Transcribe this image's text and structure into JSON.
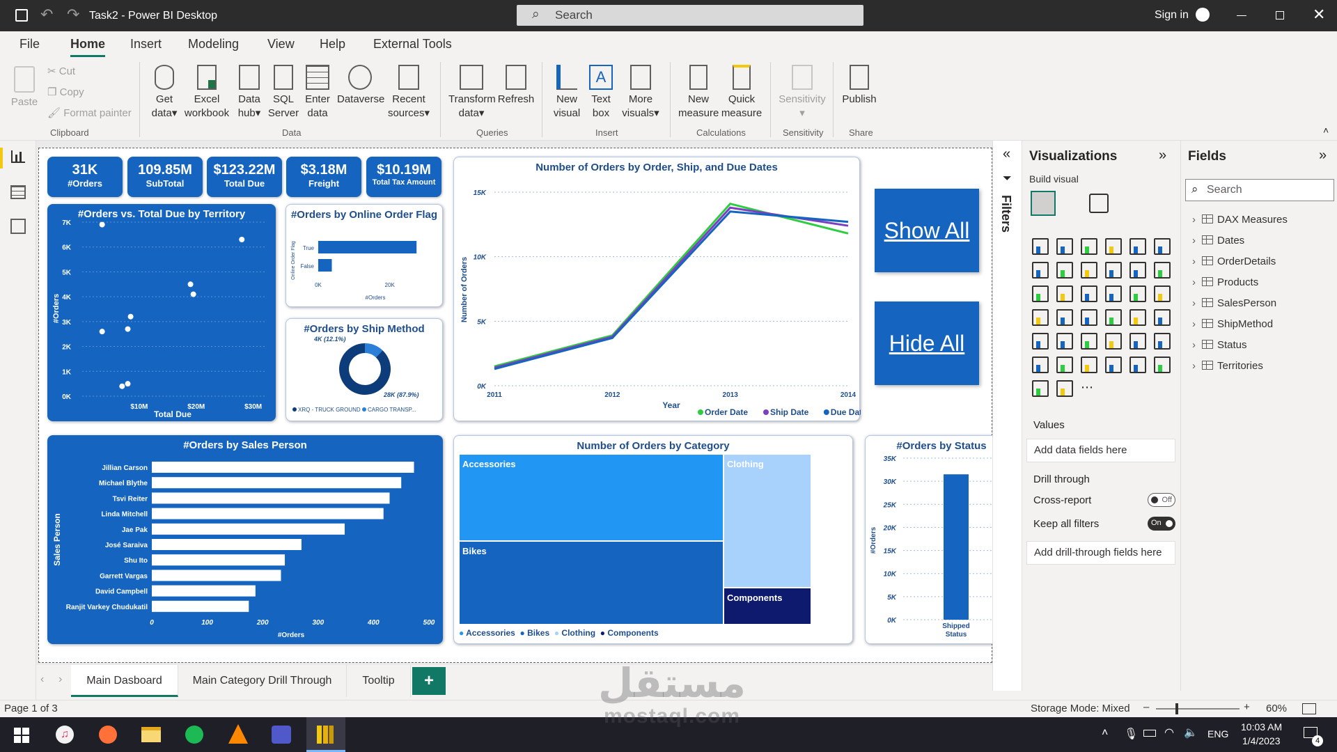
{
  "window": {
    "title": "Task2 - Power BI Desktop",
    "search_placeholder": "Search",
    "signin": "Sign in"
  },
  "ribbon": {
    "tabs": [
      "File",
      "Home",
      "Insert",
      "Modeling",
      "View",
      "Help",
      "External Tools"
    ],
    "active_tab": "Home",
    "clipboard": {
      "paste": "Paste",
      "cut": "Cut",
      "copy": "Copy",
      "format_painter": "Format painter",
      "group": "Clipboard"
    },
    "data": {
      "get_data": "Get data",
      "excel": "Excel workbook",
      "datahub": "Data hub",
      "sql": "SQL Server",
      "enter": "Enter data",
      "dataverse": "Dataverse",
      "recent": "Recent sources",
      "group": "Data"
    },
    "queries": {
      "transform": "Transform data",
      "refresh": "Refresh",
      "group": "Queries"
    },
    "insert": {
      "new_visual": "New visual",
      "text_box": "Text box",
      "more_visuals": "More visuals",
      "group": "Insert"
    },
    "calculations": {
      "new_measure": "New measure",
      "quick_measure": "Quick measure",
      "group": "Calculations"
    },
    "sensitivity": {
      "label": "Sensitivity",
      "group": "Sensitivity"
    },
    "share": {
      "publish": "Publish",
      "group": "Share"
    }
  },
  "cards": [
    {
      "value": "31K",
      "label": "#Orders"
    },
    {
      "value": "109.85M",
      "label": "SubTotal"
    },
    {
      "value": "$123.22M",
      "label": "Total Due"
    },
    {
      "value": "$3.18M",
      "label": "Freight"
    },
    {
      "value": "$10.19M",
      "label": "Total Tax Amount"
    }
  ],
  "buttons": {
    "show_all": "Show All",
    "hide_all": "Hide All"
  },
  "chart_data": [
    {
      "type": "scatter",
      "title": "#Orders vs. Total Due by Territory",
      "xlabel": "Total Due",
      "ylabel": "#Orders",
      "xticks": [
        "$10M",
        "$20M",
        "$30M"
      ],
      "yticks": [
        "0K",
        "1K",
        "2K",
        "3K",
        "4K",
        "5K",
        "6K",
        "7K"
      ],
      "xlim": [
        0,
        32
      ],
      "ylim": [
        0,
        7
      ],
      "points": [
        [
          3.5,
          6.9
        ],
        [
          28,
          6.3
        ],
        [
          19,
          4.5
        ],
        [
          19.5,
          4.1
        ],
        [
          8.5,
          3.2
        ],
        [
          3.5,
          2.6
        ],
        [
          8,
          2.7
        ],
        [
          7,
          0.4
        ],
        [
          8,
          0.5
        ]
      ]
    },
    {
      "type": "bar",
      "title": "#Orders by Online Order Flag",
      "ylabel": "Online Order Flag",
      "xlabel": "#Orders",
      "categories": [
        "True",
        "False"
      ],
      "values": [
        27.5,
        3.8
      ],
      "xticks": [
        "0K",
        "20K"
      ],
      "xlim": [
        0,
        30
      ]
    },
    {
      "type": "pie",
      "title": "#Orders by Ship Method",
      "categories": [
        "XRQ - TRUCK GROUND",
        "CARGO TRANSP..."
      ],
      "values": [
        12.1,
        87.9
      ],
      "labels": [
        "4K (12.1%)",
        "28K (87.9%)"
      ]
    },
    {
      "type": "line",
      "title": "Number of Orders by Order, Ship, and Due Dates",
      "xlabel": "Year",
      "ylabel": "Number of Orders",
      "x": [
        "2011",
        "2012",
        "2013",
        "2014"
      ],
      "yticks": [
        "0K",
        "5K",
        "10K",
        "15K"
      ],
      "ylim": [
        0,
        15
      ],
      "series": [
        {
          "name": "Order Date",
          "values": [
            1.5,
            3.9,
            14.1,
            11.8
          ],
          "color": "#2ecc40"
        },
        {
          "name": "Ship Date",
          "values": [
            1.4,
            3.8,
            13.8,
            12.4
          ],
          "color": "#7b3fbf"
        },
        {
          "name": "Due Date",
          "values": [
            1.3,
            3.7,
            13.5,
            12.7
          ],
          "color": "#1565c0"
        }
      ]
    },
    {
      "type": "bar",
      "title": "#Orders by Sales Person",
      "ylabel": "Sales Person",
      "xlabel": "#Orders",
      "categories": [
        "Jillian Carson",
        "Michael Blythe",
        "Tsvi Reiter",
        "Linda Mitchell",
        "Jae Pak",
        "José Saraiva",
        "Shu Ito",
        "Garrett Vargas",
        "David Campbell",
        "Ranjit Varkey Chudukatil"
      ],
      "values": [
        473,
        450,
        429,
        418,
        348,
        270,
        240,
        233,
        187,
        175
      ],
      "xticks": [
        "0",
        "100",
        "200",
        "300",
        "400",
        "500"
      ],
      "xlim": [
        0,
        500
      ]
    },
    {
      "type": "heatmap",
      "title": "Number of Orders by Category",
      "categories": [
        "Accessories",
        "Bikes",
        "Clothing",
        "Components"
      ],
      "legend": [
        "Accessories",
        "Bikes",
        "Clothing",
        "Components"
      ]
    },
    {
      "type": "bar",
      "title": "#Orders by Status",
      "ylabel": "#Orders",
      "xlabel": "Status",
      "categories": [
        "Shipped"
      ],
      "values": [
        31.5
      ],
      "yticks": [
        "0K",
        "5K",
        "10K",
        "15K",
        "20K",
        "25K",
        "30K",
        "35K"
      ],
      "ylim": [
        0,
        35
      ]
    }
  ],
  "filters": {
    "label": "Filters"
  },
  "viz_pane": {
    "title": "Visualizations",
    "build": "Build visual",
    "values": "Values",
    "add_data": "Add data fields here",
    "drill": "Drill through",
    "cross": "Cross-report",
    "cross_state": "Off",
    "keep": "Keep all filters",
    "keep_state": "On",
    "add_drill": "Add drill-through fields here"
  },
  "fields_pane": {
    "title": "Fields",
    "search_placeholder": "Search",
    "items": [
      "DAX Measures",
      "Dates",
      "OrderDetails",
      "Products",
      "SalesPerson",
      "ShipMethod",
      "Status",
      "Territories"
    ]
  },
  "pages": {
    "tabs": [
      "Main Dasboard",
      "Main Category Drill Through",
      "Tooltip"
    ],
    "active": "Main Dasboard",
    "add": "+"
  },
  "status": {
    "page": "Page 1 of 3",
    "storage": "Storage Mode: Mixed",
    "zoom": "60%"
  },
  "taskbar": {
    "time": "10:03 AM",
    "date": "1/4/2023",
    "lang": "ENG",
    "badge": "4"
  },
  "watermark": {
    "arabic": "مستقل",
    "url": "mostaql.com"
  }
}
